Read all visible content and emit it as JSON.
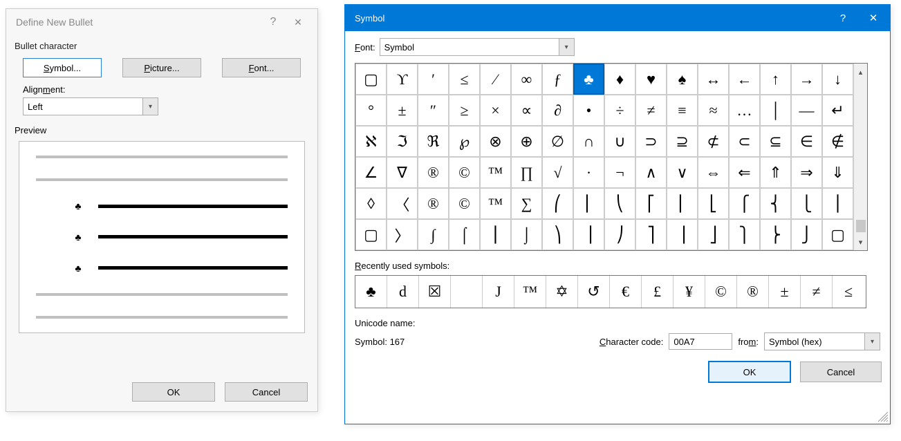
{
  "bullet_dialog": {
    "title": "Define New Bullet",
    "section_label": "Bullet character",
    "buttons": {
      "symbol": "Symbol...",
      "picture": "Picture...",
      "font": "Font..."
    },
    "alignment_label": "Alignment:",
    "alignment_value": "Left",
    "preview_label": "Preview",
    "preview_bullet_glyph": "♣",
    "ok": "OK",
    "cancel": "Cancel"
  },
  "symbol_dialog": {
    "title": "Symbol",
    "font_label": "Font:",
    "font_value": "Symbol",
    "selected_index": 7,
    "grid": [
      "▢",
      "ϒ",
      "′",
      "≤",
      "⁄",
      "∞",
      "ƒ",
      "♣",
      "♦",
      "♥",
      "♠",
      "↔",
      "←",
      "↑",
      "→",
      "↓",
      "°",
      "±",
      "″",
      "≥",
      "×",
      "∝",
      "∂",
      "•",
      "÷",
      "≠",
      "≡",
      "≈",
      "…",
      "│",
      "—",
      "↵",
      "ℵ",
      "ℑ",
      "ℜ",
      "℘",
      "⊗",
      "⊕",
      "∅",
      "∩",
      "∪",
      "⊃",
      "⊇",
      "⊄",
      "⊂",
      "⊆",
      "∈",
      "∉",
      "∠",
      "∇",
      "®",
      "©",
      "™",
      "∏",
      "√",
      "·",
      "¬",
      "∧",
      "∨",
      "⇔",
      "⇐",
      "⇑",
      "⇒",
      "⇓",
      "◊",
      "〈",
      "®",
      "©",
      "™",
      "∑",
      "⎛",
      "⎜",
      "⎝",
      "⎡",
      "⎢",
      "⎣",
      "⎧",
      "⎨",
      "⎩",
      "⎪",
      "▢",
      "〉",
      "∫",
      "⌠",
      "⎮",
      "⌡",
      "⎞",
      "⎟",
      "⎠",
      "⎤",
      "⎥",
      "⎦",
      "⎫",
      "⎬",
      "⎭",
      "▢"
    ],
    "recent_label": "Recently used symbols:",
    "recent": [
      "♣",
      "d",
      "☒",
      " ",
      "J",
      "™",
      "✡",
      "↺",
      "€",
      "£",
      "¥",
      "©",
      "®",
      "±",
      "≠",
      "≤"
    ],
    "unicode_name_label": "Unicode name:",
    "unicode_name_value": "Symbol: 167",
    "char_code_label": "Character code:",
    "char_code_value": "00A7",
    "from_label": "from:",
    "from_value": "Symbol (hex)",
    "ok": "OK",
    "cancel": "Cancel"
  }
}
